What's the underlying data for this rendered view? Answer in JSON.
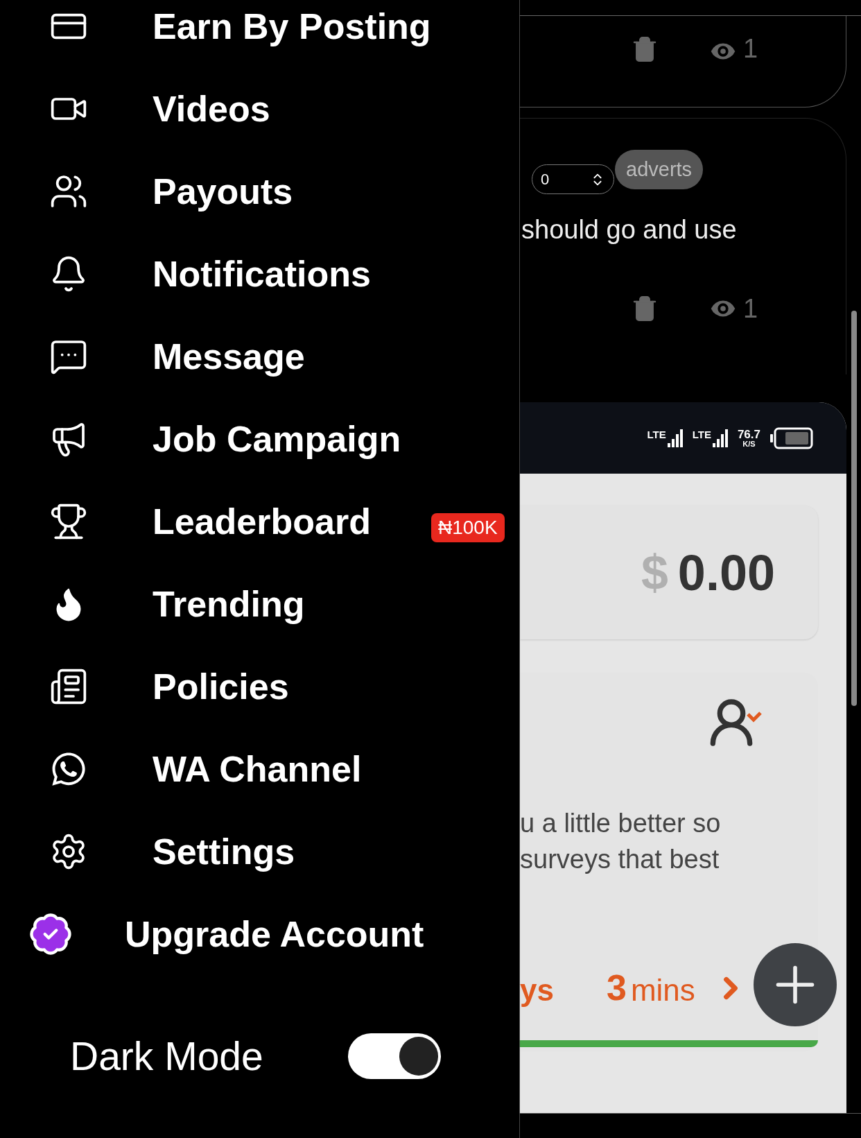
{
  "drawer": {
    "items": [
      {
        "label": "Earn By Posting"
      },
      {
        "label": "Videos"
      },
      {
        "label": "Payouts"
      },
      {
        "label": "Notifications"
      },
      {
        "label": "Message"
      },
      {
        "label": "Job Campaign"
      },
      {
        "label": "Leaderboard",
        "badge": "₦100K"
      },
      {
        "label": "Trending"
      },
      {
        "label": "Policies"
      },
      {
        "label": "WA Channel"
      },
      {
        "label": "Settings"
      }
    ],
    "upgrade": {
      "label": "Upgrade Account"
    },
    "dark_mode": {
      "label": "Dark Mode",
      "on": true
    }
  },
  "background_page": {
    "posts": [
      {
        "views": "1"
      },
      {
        "quantity": "0",
        "tag": "adverts",
        "text": "should go and use",
        "views": "1"
      }
    ],
    "screenshot": {
      "status": {
        "network_1": "LTE",
        "network_2": "LTE",
        "speed": "76.7",
        "speed_unit": "K/S"
      },
      "balance": {
        "currency": "$",
        "amount": "0.00"
      },
      "survey": {
        "lines": [
          "u a little better so",
          "surveys that best"
        ],
        "count": "ys",
        "time_value": "3",
        "time_unit": "mins"
      }
    }
  }
}
